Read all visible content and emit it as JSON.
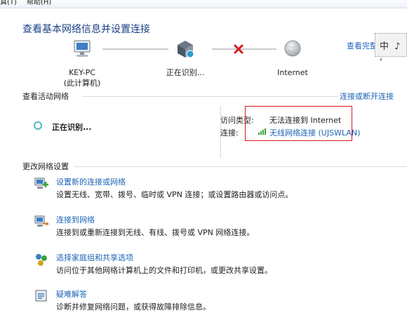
{
  "menu": {
    "item1": "真(T)",
    "item2": "帮助(H)"
  },
  "header": {
    "title": "查看基本网络信息并设置连接",
    "full_map_link": "查看完整",
    "ime_text": "中 ♪ ,"
  },
  "network_map": {
    "computer_name": "KEY-PC",
    "computer_sub": "(此计算机)",
    "middle_label": "正在识别...",
    "internet_label": "Internet"
  },
  "active_networks": {
    "heading": "查看活动网络",
    "connect_disconnect_link": "连接或断开连接",
    "status": "正在识别...",
    "access_type_label": "访问类型:",
    "access_type_value": "无法连接到 Internet",
    "connection_label": "连接:",
    "connection_value": "无线网络连接 (UJSWLAN)"
  },
  "change_settings": {
    "heading": "更改网络设置",
    "tasks": [
      {
        "link": "设置新的连接或网络",
        "desc": "设置无线、宽带、拨号、临时或 VPN 连接；或设置路由器或访问点。",
        "icon": "new-connection-icon"
      },
      {
        "link": "连接到网络",
        "desc": "连接到或重新连接到无线、有线、拨号或 VPN 网络连接。",
        "icon": "connect-network-icon"
      },
      {
        "link": "选择家庭组和共享选项",
        "desc": "访问位于其他网络计算机上的文件和打印机，或更改共享设置。",
        "icon": "homegroup-icon"
      },
      {
        "link": "疑难解答",
        "desc": "诊断并修复网络问题，或获得故障排除信息。",
        "icon": "troubleshoot-icon"
      }
    ]
  },
  "colors": {
    "link": "#1c63b7",
    "title": "#1c3f86",
    "error_x": "#d81b1b",
    "highlight_box": "#d81b1b"
  }
}
